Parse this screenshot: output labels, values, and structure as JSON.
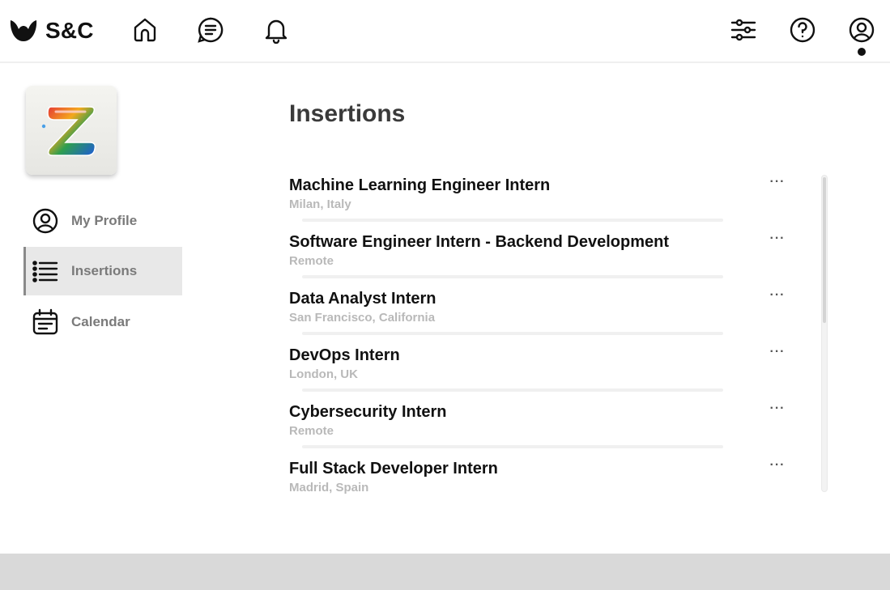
{
  "brand": {
    "name": "S&C",
    "logo_icon": "s-and-c-logo-icon"
  },
  "topnav": {
    "left_icons": [
      "home-icon",
      "chat-icon",
      "bell-icon"
    ],
    "right_icons": [
      "sliders-icon",
      "help-icon",
      "user-icon"
    ]
  },
  "sidebar": {
    "app_icon": "z-app-logo-icon",
    "items": [
      {
        "label": "My Profile",
        "icon": "user-circle-icon",
        "active": false
      },
      {
        "label": "Insertions",
        "icon": "list-icon",
        "active": true
      },
      {
        "label": "Calendar",
        "icon": "calendar-icon",
        "active": false
      }
    ]
  },
  "main": {
    "title": "Insertions",
    "items": [
      {
        "title": "Machine Learning Engineer Intern",
        "location": "Milan, Italy",
        "more": "···"
      },
      {
        "title": "Software Engineer Intern - Backend Development",
        "location": "Remote",
        "more": "···"
      },
      {
        "title": "Data Analyst Intern",
        "location": "San Francisco, California",
        "more": "···"
      },
      {
        "title": "DevOps Intern",
        "location": "London, UK",
        "more": "···"
      },
      {
        "title": "Cybersecurity Intern",
        "location": "Remote",
        "more": "···"
      },
      {
        "title": "Full Stack Developer Intern",
        "location": "Madrid, Spain",
        "more": "···"
      }
    ]
  },
  "colors": {
    "active_bg": "#e8e8e8",
    "footer": "#d9d9d9",
    "muted_text": "#b9b9b9"
  }
}
